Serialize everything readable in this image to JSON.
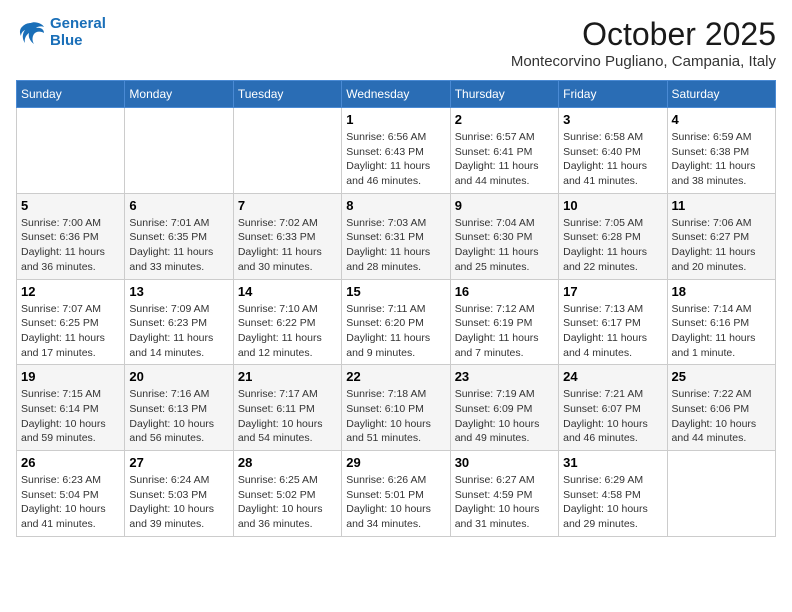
{
  "header": {
    "logo_line1": "General",
    "logo_line2": "Blue",
    "month": "October 2025",
    "location": "Montecorvino Pugliano, Campania, Italy"
  },
  "days_of_week": [
    "Sunday",
    "Monday",
    "Tuesday",
    "Wednesday",
    "Thursday",
    "Friday",
    "Saturday"
  ],
  "weeks": [
    [
      {
        "day": "",
        "info": ""
      },
      {
        "day": "",
        "info": ""
      },
      {
        "day": "",
        "info": ""
      },
      {
        "day": "1",
        "info": "Sunrise: 6:56 AM\nSunset: 6:43 PM\nDaylight: 11 hours and 46 minutes."
      },
      {
        "day": "2",
        "info": "Sunrise: 6:57 AM\nSunset: 6:41 PM\nDaylight: 11 hours and 44 minutes."
      },
      {
        "day": "3",
        "info": "Sunrise: 6:58 AM\nSunset: 6:40 PM\nDaylight: 11 hours and 41 minutes."
      },
      {
        "day": "4",
        "info": "Sunrise: 6:59 AM\nSunset: 6:38 PM\nDaylight: 11 hours and 38 minutes."
      }
    ],
    [
      {
        "day": "5",
        "info": "Sunrise: 7:00 AM\nSunset: 6:36 PM\nDaylight: 11 hours and 36 minutes."
      },
      {
        "day": "6",
        "info": "Sunrise: 7:01 AM\nSunset: 6:35 PM\nDaylight: 11 hours and 33 minutes."
      },
      {
        "day": "7",
        "info": "Sunrise: 7:02 AM\nSunset: 6:33 PM\nDaylight: 11 hours and 30 minutes."
      },
      {
        "day": "8",
        "info": "Sunrise: 7:03 AM\nSunset: 6:31 PM\nDaylight: 11 hours and 28 minutes."
      },
      {
        "day": "9",
        "info": "Sunrise: 7:04 AM\nSunset: 6:30 PM\nDaylight: 11 hours and 25 minutes."
      },
      {
        "day": "10",
        "info": "Sunrise: 7:05 AM\nSunset: 6:28 PM\nDaylight: 11 hours and 22 minutes."
      },
      {
        "day": "11",
        "info": "Sunrise: 7:06 AM\nSunset: 6:27 PM\nDaylight: 11 hours and 20 minutes."
      }
    ],
    [
      {
        "day": "12",
        "info": "Sunrise: 7:07 AM\nSunset: 6:25 PM\nDaylight: 11 hours and 17 minutes."
      },
      {
        "day": "13",
        "info": "Sunrise: 7:09 AM\nSunset: 6:23 PM\nDaylight: 11 hours and 14 minutes."
      },
      {
        "day": "14",
        "info": "Sunrise: 7:10 AM\nSunset: 6:22 PM\nDaylight: 11 hours and 12 minutes."
      },
      {
        "day": "15",
        "info": "Sunrise: 7:11 AM\nSunset: 6:20 PM\nDaylight: 11 hours and 9 minutes."
      },
      {
        "day": "16",
        "info": "Sunrise: 7:12 AM\nSunset: 6:19 PM\nDaylight: 11 hours and 7 minutes."
      },
      {
        "day": "17",
        "info": "Sunrise: 7:13 AM\nSunset: 6:17 PM\nDaylight: 11 hours and 4 minutes."
      },
      {
        "day": "18",
        "info": "Sunrise: 7:14 AM\nSunset: 6:16 PM\nDaylight: 11 hours and 1 minute."
      }
    ],
    [
      {
        "day": "19",
        "info": "Sunrise: 7:15 AM\nSunset: 6:14 PM\nDaylight: 10 hours and 59 minutes."
      },
      {
        "day": "20",
        "info": "Sunrise: 7:16 AM\nSunset: 6:13 PM\nDaylight: 10 hours and 56 minutes."
      },
      {
        "day": "21",
        "info": "Sunrise: 7:17 AM\nSunset: 6:11 PM\nDaylight: 10 hours and 54 minutes."
      },
      {
        "day": "22",
        "info": "Sunrise: 7:18 AM\nSunset: 6:10 PM\nDaylight: 10 hours and 51 minutes."
      },
      {
        "day": "23",
        "info": "Sunrise: 7:19 AM\nSunset: 6:09 PM\nDaylight: 10 hours and 49 minutes."
      },
      {
        "day": "24",
        "info": "Sunrise: 7:21 AM\nSunset: 6:07 PM\nDaylight: 10 hours and 46 minutes."
      },
      {
        "day": "25",
        "info": "Sunrise: 7:22 AM\nSunset: 6:06 PM\nDaylight: 10 hours and 44 minutes."
      }
    ],
    [
      {
        "day": "26",
        "info": "Sunrise: 6:23 AM\nSunset: 5:04 PM\nDaylight: 10 hours and 41 minutes."
      },
      {
        "day": "27",
        "info": "Sunrise: 6:24 AM\nSunset: 5:03 PM\nDaylight: 10 hours and 39 minutes."
      },
      {
        "day": "28",
        "info": "Sunrise: 6:25 AM\nSunset: 5:02 PM\nDaylight: 10 hours and 36 minutes."
      },
      {
        "day": "29",
        "info": "Sunrise: 6:26 AM\nSunset: 5:01 PM\nDaylight: 10 hours and 34 minutes."
      },
      {
        "day": "30",
        "info": "Sunrise: 6:27 AM\nSunset: 4:59 PM\nDaylight: 10 hours and 31 minutes."
      },
      {
        "day": "31",
        "info": "Sunrise: 6:29 AM\nSunset: 4:58 PM\nDaylight: 10 hours and 29 minutes."
      },
      {
        "day": "",
        "info": ""
      }
    ]
  ]
}
